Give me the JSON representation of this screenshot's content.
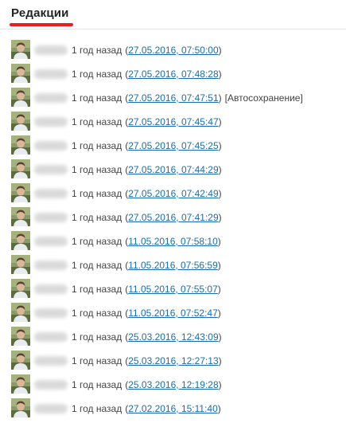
{
  "header": {
    "title": "Редакции",
    "accent_color": "#ee1c1c"
  },
  "link_color": "#1a6ea8",
  "revisions": [
    {
      "ago": "1 год назад",
      "date": "27.05.2016, 07:50:00",
      "note": ""
    },
    {
      "ago": "1 год назад",
      "date": "27.05.2016, 07:48:28",
      "note": ""
    },
    {
      "ago": "1 год назад",
      "date": "27.05.2016, 07:47:51",
      "note": "[Автосохранение]"
    },
    {
      "ago": "1 год назад",
      "date": "27.05.2016, 07:45:47",
      "note": ""
    },
    {
      "ago": "1 год назад",
      "date": "27.05.2016, 07:45:25",
      "note": ""
    },
    {
      "ago": "1 год назад",
      "date": "27.05.2016, 07:44:29",
      "note": ""
    },
    {
      "ago": "1 год назад",
      "date": "27.05.2016, 07:42:49",
      "note": ""
    },
    {
      "ago": "1 год назад",
      "date": "27.05.2016, 07:41:29",
      "note": ""
    },
    {
      "ago": "1 год назад",
      "date": "11.05.2016, 07:58:10",
      "note": ""
    },
    {
      "ago": "1 год назад",
      "date": "11.05.2016, 07:56:59",
      "note": ""
    },
    {
      "ago": "1 год назад",
      "date": "11.05.2016, 07:55:07",
      "note": ""
    },
    {
      "ago": "1 год назад",
      "date": "11.05.2016, 07:52:47",
      "note": ""
    },
    {
      "ago": "1 год назад",
      "date": "25.03.2016, 12:43:09",
      "note": ""
    },
    {
      "ago": "1 год назад",
      "date": "25.03.2016, 12:27:13",
      "note": ""
    },
    {
      "ago": "1 год назад",
      "date": "25.03.2016, 12:19:28",
      "note": ""
    },
    {
      "ago": "1 год назад",
      "date": "27.02.2016, 15:11:40",
      "note": ""
    }
  ]
}
